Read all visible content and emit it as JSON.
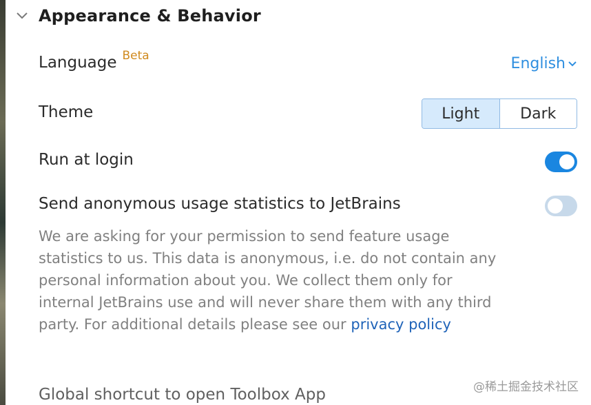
{
  "section": {
    "title": "Appearance & Behavior"
  },
  "language": {
    "label": "Language",
    "badge": "Beta",
    "value": "English"
  },
  "theme": {
    "label": "Theme",
    "options": [
      "Light",
      "Dark"
    ],
    "selected": "Light"
  },
  "run_at_login": {
    "label": "Run at login",
    "enabled": true
  },
  "usage_stats": {
    "label": "Send anonymous usage statistics to JetBrains",
    "enabled": false,
    "description": "We are asking for your permission to send feature usage statistics to us. This data is anonymous, i.e. do not contain any personal information about you. We collect them only for internal JetBrains use and will never share them with any third party. For additional details please see our",
    "link_text": "privacy policy"
  },
  "global_shortcut": {
    "label": "Global shortcut to open Toolbox App"
  },
  "watermark": {
    "text": "@稀土掘金技术社区"
  },
  "colors": {
    "accent": "#1a86e0",
    "beta": "#d08a1e",
    "link": "#2f8fe0"
  },
  "icons": {
    "section_toggle": "chevron-down-icon",
    "language_dropdown": "chevron-down-icon"
  }
}
